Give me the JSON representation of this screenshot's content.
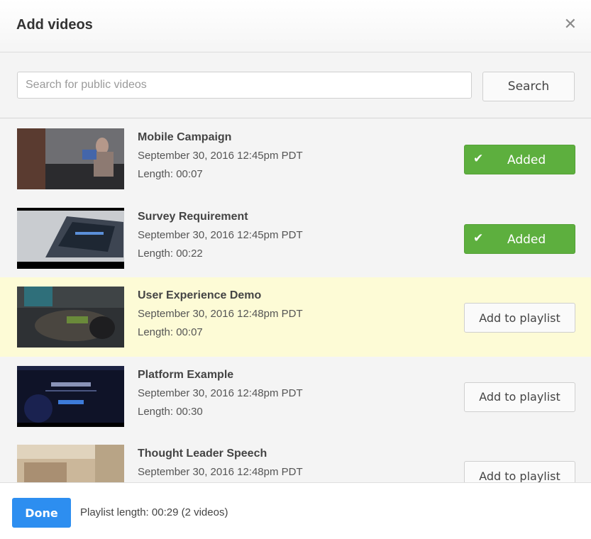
{
  "dialog": {
    "title": "Add videos",
    "close_icon": "close-icon"
  },
  "search": {
    "placeholder": "Search for public videos",
    "value": "",
    "button_label": "Search"
  },
  "videos": [
    {
      "title": "Mobile Campaign",
      "date": "September 30, 2016 12:45pm PDT",
      "length": "Length: 00:07",
      "status": "added",
      "button_label": "Added",
      "highlighted": false
    },
    {
      "title": "Survey Requirement",
      "date": "September 30, 2016 12:45pm PDT",
      "length": "Length: 00:22",
      "status": "added",
      "button_label": "Added",
      "highlighted": false
    },
    {
      "title": "User Experience Demo",
      "date": "September 30, 2016 12:48pm PDT",
      "length": "Length: 00:07",
      "status": "not_added",
      "button_label": "Add to playlist",
      "highlighted": true
    },
    {
      "title": "Platform Example",
      "date": "September 30, 2016 12:48pm PDT",
      "length": "Length: 00:30",
      "status": "not_added",
      "button_label": "Add to playlist",
      "highlighted": false
    },
    {
      "title": "Thought Leader Speech",
      "date": "September 30, 2016 12:48pm PDT",
      "length": "",
      "status": "not_added",
      "button_label": "Add to playlist",
      "highlighted": false
    }
  ],
  "footer": {
    "done_label": "Done",
    "playlist_length": "Playlist length: 00:29 (2 videos)"
  },
  "colors": {
    "added_green": "#5daf3e",
    "done_blue": "#2d8ef0",
    "highlight_yellow": "#fdfbd6"
  }
}
